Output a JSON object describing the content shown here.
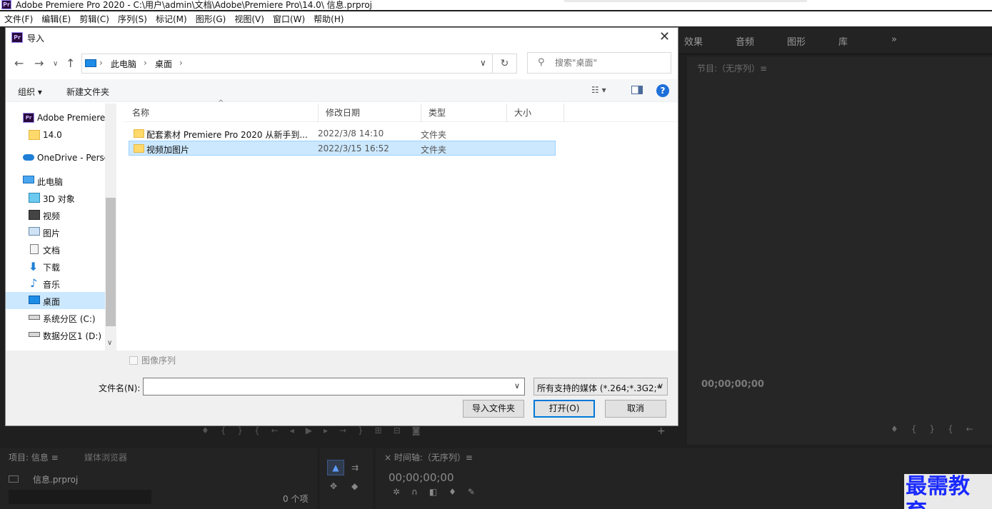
{
  "premiere": {
    "title": "Adobe Premiere Pro 2020 - C:\\用户\\admin\\文档\\Adobe\\Premiere Pro\\14.0\\ 信息.prproj",
    "menu": [
      "文件(F)",
      "编辑(E)",
      "剪辑(C)",
      "序列(S)",
      "标记(M)",
      "图形(G)",
      "视图(V)",
      "窗口(W)",
      "帮助(H)"
    ],
    "panel_tabs": [
      "效果",
      "音频",
      "图形",
      "库"
    ],
    "panel_more": "»",
    "program_title": "节目:（无序列）≡",
    "program_timecode": "00;00;00;00",
    "project_tab": "项目: 信息 ≡",
    "media_browser_tab": "媒体浏览器",
    "project_file": "信息.prproj",
    "item_count": "0 个项",
    "timeline_title": "时间轴:（无序列）≡",
    "timeline_close": "×",
    "timeline_timecode": "00;00;00;00",
    "watermark": "最需教育"
  },
  "dialog": {
    "title": "导入",
    "breadcrumb": [
      "此电脑",
      "桌面"
    ],
    "search_placeholder": "搜索\"桌面\"",
    "toolbar": {
      "organize": "组织 ▾",
      "new_folder": "新建文件夹",
      "help": "?"
    },
    "sidebar": [
      {
        "label": "Adobe Premiere",
        "icon": "premiere-icon"
      },
      {
        "label": "14.0",
        "icon": "folder-icon"
      },
      {
        "label": "OneDrive - Perso",
        "icon": "cloud-icon"
      },
      {
        "label": "此电脑",
        "icon": "computer-icon"
      },
      {
        "label": "3D 对象",
        "icon": "cube-icon"
      },
      {
        "label": "视频",
        "icon": "video-icon"
      },
      {
        "label": "图片",
        "icon": "picture-icon"
      },
      {
        "label": "文档",
        "icon": "document-icon"
      },
      {
        "label": "下载",
        "icon": "download-icon"
      },
      {
        "label": "音乐",
        "icon": "music-icon"
      },
      {
        "label": "桌面",
        "icon": "desktop-icon",
        "selected": true
      },
      {
        "label": "系统分区 (C:)",
        "icon": "drive-icon"
      },
      {
        "label": "数据分区1 (D:)",
        "icon": "drive-icon"
      }
    ],
    "columns": [
      "名称",
      "修改日期",
      "类型",
      "大小"
    ],
    "rows": [
      {
        "name": "配套素材 Premiere Pro 2020 从新手到...",
        "date": "2022/3/8 14:10",
        "type": "文件夹"
      },
      {
        "name": "视频加图片",
        "date": "2022/3/15 16:52",
        "type": "文件夹",
        "selected": true
      }
    ],
    "image_sequence_label": "图像序列",
    "filename_label": "文件名(N):",
    "filename_value": "",
    "filter_label": "所有支持的媒体 (*.264;*.3G2;*",
    "buttons": {
      "import_folder": "导入文件夹",
      "open": "打开(O)",
      "cancel": "取消"
    },
    "colors": {
      "accent": "#0078d7",
      "selection": "#cce8ff",
      "folder": "#ffd96b"
    }
  }
}
